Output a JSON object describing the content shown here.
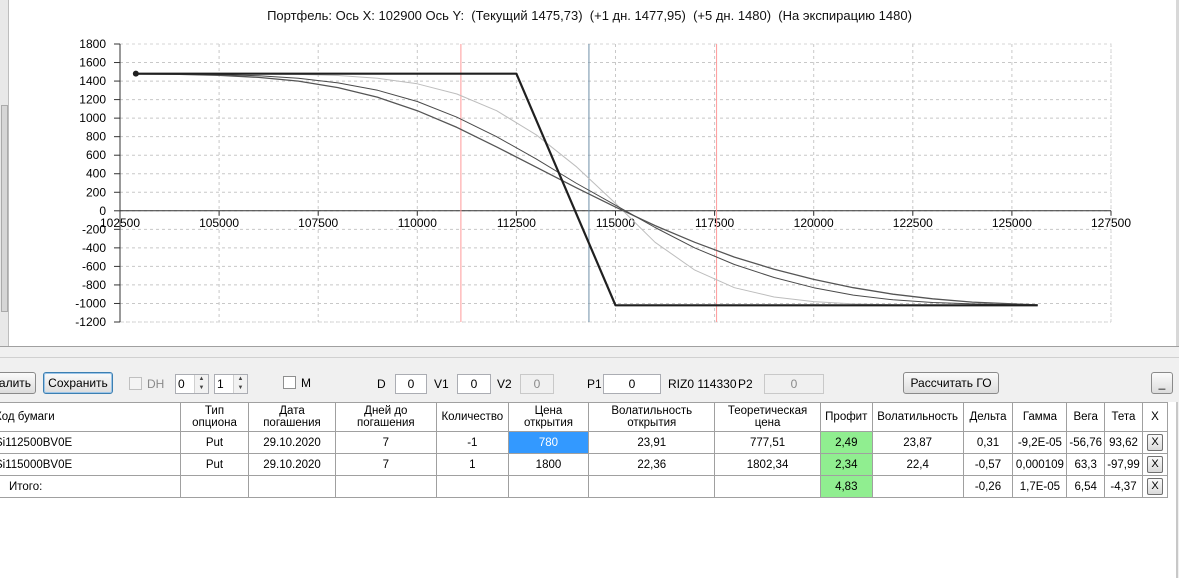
{
  "chart": {
    "title": "Портфель: Ось X: 102900 Ось Y:  (Текущий 1475,73)  (+1 дн. 1477,95)  (+5 дн. 1480)  (На экспирацию 1480)",
    "x_ticks": [
      "102500",
      "105000",
      "107500",
      "110000",
      "112500",
      "115000",
      "117500",
      "120000",
      "122500",
      "125000",
      "127500"
    ],
    "y_ticks": [
      "1800",
      "1600",
      "1400",
      "1200",
      "1000",
      "800",
      "600",
      "400",
      "200",
      "0",
      "-200",
      "-400",
      "-600",
      "-800",
      "-1000",
      "-1200"
    ]
  },
  "chart_data": {
    "type": "line",
    "title": "Портфель: Ось X: 102900 Ось Y:  (Текущий 1475,73)  (+1 дн. 1477,95)  (+5 дн. 1480)  (На экспирацию 1480)",
    "xlim": [
      102500,
      127500
    ],
    "ylim": [
      -1200,
      1800
    ],
    "grid": true,
    "vertical_markers": [
      {
        "x": 111100,
        "color": "#ff9a9a"
      },
      {
        "x": 114330,
        "color": "#6f8fa8"
      },
      {
        "x": 117550,
        "color": "#ff9a9a"
      }
    ],
    "series": [
      {
        "color": "#202020",
        "width": 2.2,
        "x": [
          102900,
          112500,
          115000,
          125650
        ],
        "y": [
          1480,
          1480,
          -1020,
          -1020
        ]
      },
      {
        "color": "#555555",
        "width": 1.3,
        "x": [
          102900,
          104000,
          105000,
          106000,
          107000,
          108000,
          109000,
          110000,
          111000,
          112000,
          113000,
          114000,
          115000,
          116000,
          117000,
          118000,
          119000,
          120000,
          121000,
          122000,
          123000,
          124000,
          125650
        ],
        "y": [
          1476,
          1472,
          1462,
          1440,
          1400,
          1330,
          1225,
          1080,
          900,
          690,
          470,
          250,
          40,
          -160,
          -340,
          -500,
          -630,
          -740,
          -830,
          -900,
          -950,
          -985,
          -1015
        ]
      },
      {
        "color": "#4a4a4a",
        "width": 1.0,
        "x": [
          102900,
          104000,
          105000,
          106000,
          107000,
          108000,
          109000,
          110000,
          111000,
          112000,
          113000,
          114000,
          115000,
          116000,
          117000,
          118000,
          119000,
          120000,
          121000,
          122000,
          123000,
          124000,
          125650
        ],
        "y": [
          1478,
          1476,
          1470,
          1458,
          1430,
          1380,
          1300,
          1180,
          1010,
          800,
          560,
          300,
          60,
          -180,
          -400,
          -580,
          -720,
          -830,
          -910,
          -960,
          -990,
          -1005,
          -1018
        ]
      },
      {
        "color": "#bdbdbd",
        "width": 1.0,
        "x": [
          102900,
          104000,
          105000,
          106000,
          107000,
          108000,
          109000,
          110000,
          111000,
          112000,
          113000,
          114000,
          115000,
          116000,
          117000,
          118000,
          119000,
          120000,
          121000,
          122000,
          123000,
          125650
        ],
        "y": [
          1480,
          1480,
          1479,
          1477,
          1472,
          1460,
          1430,
          1370,
          1260,
          1080,
          820,
          480,
          80,
          -340,
          -640,
          -830,
          -930,
          -980,
          -1005,
          -1015,
          -1019,
          -1020
        ]
      }
    ]
  },
  "toolbar": {
    "delete_label": "алить",
    "save_label": "Сохранить",
    "dh_label": "DH",
    "spin1_value": "0",
    "spin2_value": "1",
    "m_label": "M",
    "d_label": "D",
    "d_value": "0",
    "v1_label": "V1",
    "v1_value": "0",
    "v2_label": "V2",
    "v2_value": "0",
    "p1_label": "P1",
    "p1_value": "0",
    "riz_label": "RIZ0 114330",
    "p2_label": "P2",
    "p2_value": "0",
    "calc_label": "Рассчитать ГО",
    "minimize_label": "_"
  },
  "table": {
    "headers": [
      "Код бумаги",
      "Тип опциона",
      "Дата погашения",
      "Дней до погашения",
      "Количество",
      "Цена открытия",
      "Волатильность открытия",
      "Теоретическая цена",
      "Профит",
      "Волатильность",
      "Дельта",
      "Гамма",
      "Вега",
      "Тета",
      "X"
    ],
    "rows": [
      [
        "Si112500BV0E",
        "Put",
        "29.10.2020",
        "7",
        "-1",
        "780",
        "23,91",
        "777,51",
        "2,49",
        "23,87",
        "0,31",
        "-9,2E-05",
        "-56,76",
        "93,62",
        "X"
      ],
      [
        "Si115000BV0E",
        "Put",
        "29.10.2020",
        "7",
        "1",
        "1800",
        "22,36",
        "1802,34",
        "2,34",
        "22,4",
        "-0,57",
        "0,000109",
        "63,3",
        "-97,99",
        "X"
      ],
      [
        "Итого:",
        "",
        "",
        "",
        "",
        "",
        "",
        "",
        "4,83",
        "",
        "-0,26",
        "1,7E-05",
        "6,54",
        "-4,37",
        "X"
      ]
    ]
  }
}
